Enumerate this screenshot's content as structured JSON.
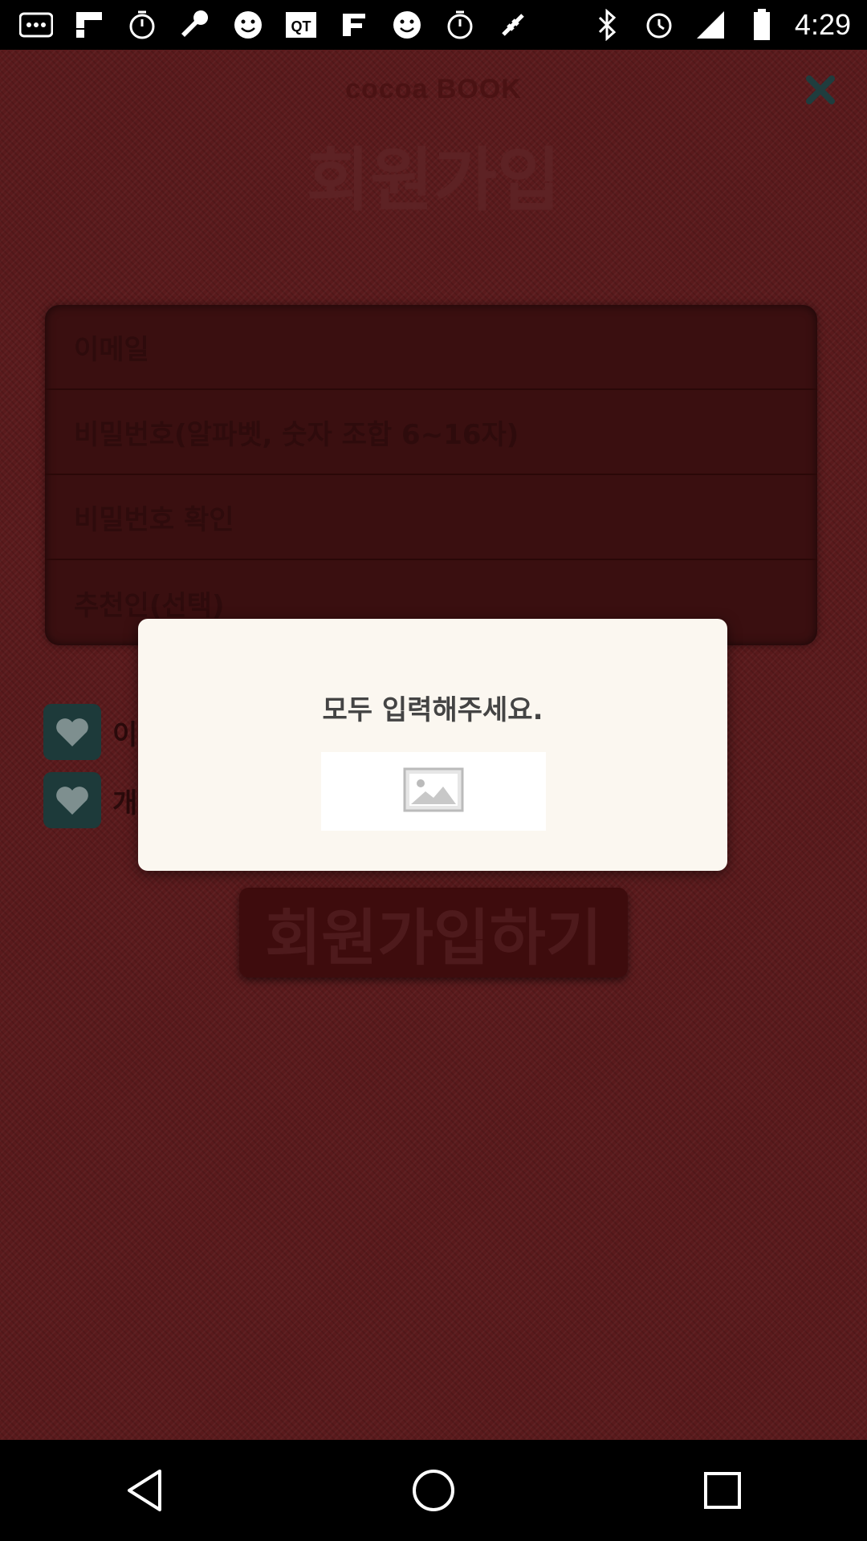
{
  "status_bar": {
    "time": "4:29",
    "icons": [
      "more-icon",
      "flipboard-icon",
      "timer-icon",
      "wrench-icon",
      "smiley-icon",
      "qt-icon",
      "fabric-icon",
      "smiley-icon",
      "timer-icon",
      "fake-gps-icon",
      "bluetooth-icon",
      "alarm-icon",
      "signal-icon",
      "battery-icon"
    ]
  },
  "header": {
    "brand": "cocoa BOOK",
    "title": "회원가입"
  },
  "form": {
    "email_placeholder": "이메일",
    "password_placeholder": "비밀번호(알파벳, 숫자 조합 6~16자)",
    "password_confirm_placeholder": "비밀번호 확인",
    "referrer_placeholder": "추천인(선택)"
  },
  "checks": [
    {
      "label": "이"
    },
    {
      "label": "개"
    }
  ],
  "signup_button": {
    "label": "회원가입하기"
  },
  "dialog": {
    "message": "모두 입력해주세요."
  },
  "colors": {
    "background": "#5a1a1c",
    "dialog": "#fbf7f0",
    "check": "#1d3a3a"
  }
}
